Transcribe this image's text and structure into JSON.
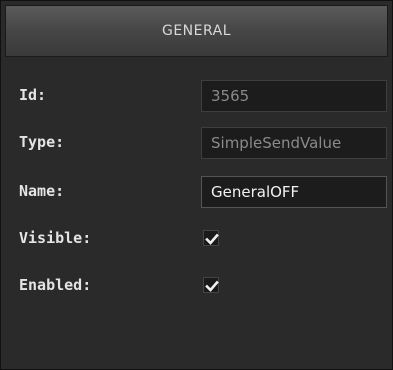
{
  "header": {
    "title": "GENERAL"
  },
  "properties": {
    "id": {
      "label": "Id:",
      "value": "3565"
    },
    "type": {
      "label": "Type:",
      "value": "SimpleSendValue"
    },
    "name": {
      "label": "Name:",
      "value": "GeneralOFF"
    },
    "visible": {
      "label": "Visible:",
      "checked": true
    },
    "enabled": {
      "label": "Enabled:",
      "checked": true
    }
  }
}
